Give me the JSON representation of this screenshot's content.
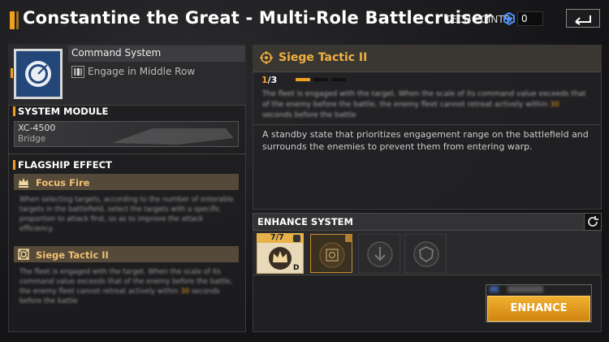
{
  "header": {
    "title": "Constantine the Great - Multi-Role Battlecruiser",
    "tech_points_label": "TECH POINTS:",
    "tech_points_value": "0",
    "back_icon": "back-arrow-icon"
  },
  "command": {
    "label": "Command System",
    "engage_text": "Engage in Middle Row",
    "icon": "command-target-icon"
  },
  "system_module": {
    "title": "SYSTEM MODULE",
    "code": "XC-4500",
    "name": "Bridge"
  },
  "flagship_effect": {
    "title": "FLAGSHIP EFFECT",
    "effects": [
      {
        "name": "Focus Fire",
        "icon": "crown-icon",
        "description": "When selecting targets, according to the number of enterable targets in the battlefield, select the targets with a specific proportion to attack first, so as to improve the attack efficiency."
      },
      {
        "name": "Siege Tactic II",
        "icon": "siege-icon",
        "description_pre": "The fleet is engaged with the target. When the scale of its command value exceeds that of the enemy before the battle, the enemy fleet cannot retreat actively within",
        "description_hl": "30",
        "description_post": "seconds before the battle"
      }
    ]
  },
  "skill": {
    "title": "Siege Tactic  II",
    "icon": "target-icon",
    "level_current": "1",
    "level_max": "/3",
    "level_progress": 0.33,
    "effect_pre": "The fleet is engaged with the target. When the scale of its command value exceeds that of the enemy before the battle, the enemy fleet cannot retreat actively within",
    "effect_hl": "30",
    "effect_post": "seconds before the battle",
    "description": "A standby state that prioritizes engagement range on the battlefield and surrounds the enemies to prevent them from entering warp."
  },
  "enhance": {
    "title": "ENHANCE SYSTEM",
    "refresh_icon": "refresh-icon",
    "slots": [
      {
        "count": "7/7",
        "icon": "crown-icon",
        "tag": "D",
        "state": "owned"
      },
      {
        "icon": "siege-icon",
        "state": "selected"
      },
      {
        "icon": "arrow-down-icon",
        "state": "locked"
      },
      {
        "icon": "shield-icon",
        "state": "locked"
      }
    ],
    "button_label": "ENHANCE"
  },
  "colors": {
    "accent": "#f0a020",
    "command_icon_bg": "#24477a",
    "enhance_button": "#e0a020"
  }
}
